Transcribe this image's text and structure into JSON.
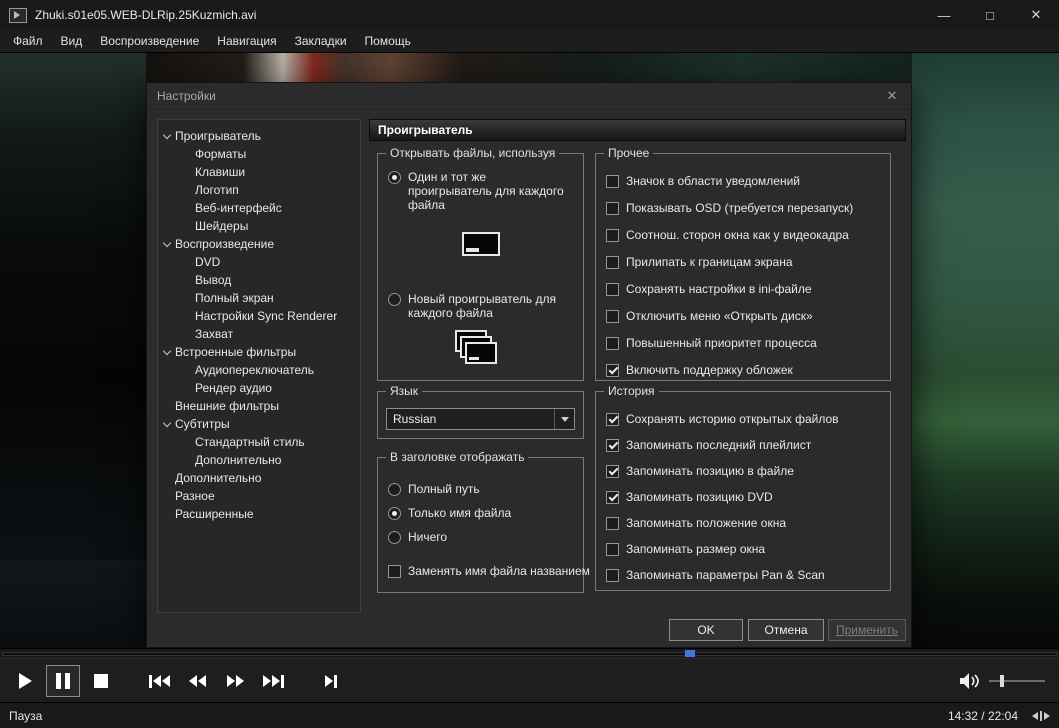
{
  "colors": {
    "accent_blue": "#3f79dd",
    "dialog_bg": "#2b2b2b"
  },
  "window": {
    "title": "Zhuki.s01e05.WEB-DLRip.25Kuzmich.avi",
    "controls": {
      "minimize": "—",
      "maximize": "□",
      "close": "✕"
    }
  },
  "menu": {
    "items": [
      {
        "label": "Файл"
      },
      {
        "label": "Вид"
      },
      {
        "label": "Воспроизведение"
      },
      {
        "label": "Навигация"
      },
      {
        "label": "Закладки"
      },
      {
        "label": "Помощь"
      }
    ]
  },
  "dialog": {
    "title": "Настройки",
    "close_glyph": "✕",
    "panel_header": "Проигрыватель",
    "tree": [
      {
        "label": "Проигрыватель",
        "level": 0,
        "expandable": true
      },
      {
        "label": "Форматы",
        "level": 1
      },
      {
        "label": "Клавиши",
        "level": 1
      },
      {
        "label": "Логотип",
        "level": 1
      },
      {
        "label": "Веб-интерфейс",
        "level": 1
      },
      {
        "label": "Шейдеры",
        "level": 1
      },
      {
        "label": "Воспроизведение",
        "level": 0,
        "expandable": true
      },
      {
        "label": "DVD",
        "level": 1
      },
      {
        "label": "Вывод",
        "level": 1
      },
      {
        "label": "Полный экран",
        "level": 1
      },
      {
        "label": "Настройки Sync Renderer",
        "level": 1
      },
      {
        "label": "Захват",
        "level": 1
      },
      {
        "label": "Встроенные фильтры",
        "level": 0,
        "expandable": true
      },
      {
        "label": "Аудиопереключатель",
        "level": 1
      },
      {
        "label": "Рендер аудио",
        "level": 1
      },
      {
        "label": "Внешние фильтры",
        "level": 0
      },
      {
        "label": "Субтитры",
        "level": 0,
        "expandable": true
      },
      {
        "label": "Стандартный стиль",
        "level": 1
      },
      {
        "label": "Дополнительно",
        "level": 1
      },
      {
        "label": "Дополнительно",
        "level": 0
      },
      {
        "label": "Разное",
        "level": 0
      },
      {
        "label": "Расширенные",
        "level": 0
      }
    ],
    "open_with": {
      "title": "Открывать файлы, используя",
      "options": [
        {
          "label": "Один и тот же проигрыватель для каждого файла",
          "state": "selected"
        },
        {
          "label": "Новый проигрыватель для каждого файла",
          "state": "unselected"
        }
      ]
    },
    "language": {
      "title": "Язык",
      "value": "Russian"
    },
    "title_display": {
      "title": "В заголовке отображать",
      "options": [
        {
          "label": "Полный путь",
          "state": "unselected"
        },
        {
          "label": "Только имя файла",
          "state": "selected"
        },
        {
          "label": "Ничего",
          "state": "unselected"
        }
      ],
      "checkbox": {
        "label": "Заменять имя файла названием",
        "state": "unchecked"
      }
    },
    "misc": {
      "title": "Прочее",
      "items": [
        {
          "label": "Значок в области уведомлений",
          "state": "unchecked"
        },
        {
          "label": "Показывать OSD (требуется перезапуск)",
          "state": "unchecked"
        },
        {
          "label": "Соотнош. сторон окна как у видеокадра",
          "state": "unchecked"
        },
        {
          "label": "Прилипать к границам экрана",
          "state": "unchecked"
        },
        {
          "label": "Сохранять настройки в ini-файле",
          "state": "unchecked"
        },
        {
          "label": "Отключить меню «Открыть диск»",
          "state": "unchecked"
        },
        {
          "label": "Повышенный приоритет процесса",
          "state": "unchecked"
        },
        {
          "label": "Включить поддержку обложек",
          "state": "checked"
        }
      ]
    },
    "history": {
      "title": "История",
      "items": [
        {
          "label": "Сохранять историю открытых файлов",
          "state": "checked"
        },
        {
          "label": "Запоминать последний плейлист",
          "state": "checked"
        },
        {
          "label": "Запоминать позицию в файле",
          "state": "checked"
        },
        {
          "label": "Запоминать позицию DVD",
          "state": "checked"
        },
        {
          "label": "Запоминать положение окна",
          "state": "unchecked"
        },
        {
          "label": "Запоминать размер окна",
          "state": "unchecked"
        },
        {
          "label": "Запоминать параметры Pan & Scan",
          "state": "unchecked"
        }
      ]
    },
    "buttons": {
      "ok": "OK",
      "cancel": "Отмена",
      "apply": "Применить"
    }
  },
  "transport": {
    "seek_position_percent": 65.2,
    "volume_percent": 20
  },
  "statusbar": {
    "status": "Пауза",
    "time": "14:32 / 22:04"
  }
}
